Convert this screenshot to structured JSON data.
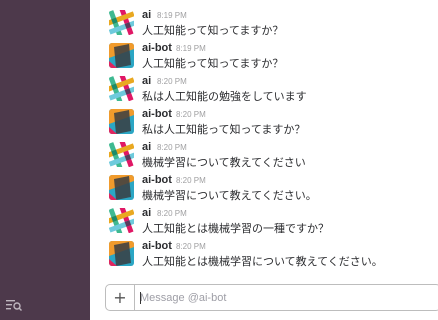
{
  "messages": [
    {
      "user": "ai",
      "time": "8:19 PM",
      "text": "人工知能って知ってますか？",
      "avatar": "slack-logo-icon"
    },
    {
      "user": "ai-bot",
      "time": "8:19 PM",
      "text": "人工知能って知ってますか？",
      "avatar": "bot-avatar-icon"
    },
    {
      "user": "ai",
      "time": "8:20 PM",
      "text": "私は人工知能の勉強をしています",
      "avatar": "slack-logo-icon"
    },
    {
      "user": "ai-bot",
      "time": "8:20 PM",
      "text": "私は人工知能って知ってますか？",
      "avatar": "bot-avatar-icon"
    },
    {
      "user": "ai",
      "time": "8:20 PM",
      "text": "機械学習について教えてください",
      "avatar": "slack-logo-icon"
    },
    {
      "user": "ai-bot",
      "time": "8:20 PM",
      "text": "機械学習について教えてください。",
      "avatar": "bot-avatar-icon"
    },
    {
      "user": "ai",
      "time": "8:20 PM",
      "text": "人工知能とは機械学習の一種ですか？",
      "avatar": "slack-logo-icon"
    },
    {
      "user": "ai-bot",
      "time": "8:20 PM",
      "text": "人工知能とは機械学習について教えてください。",
      "avatar": "bot-avatar-icon"
    }
  ],
  "composer": {
    "plus_label": "+",
    "placeholder": "Message @ai-bot"
  },
  "colors": {
    "sidebar": "#4d394b",
    "name": "#2c2d30",
    "timestamp": "#a0a0a2"
  }
}
